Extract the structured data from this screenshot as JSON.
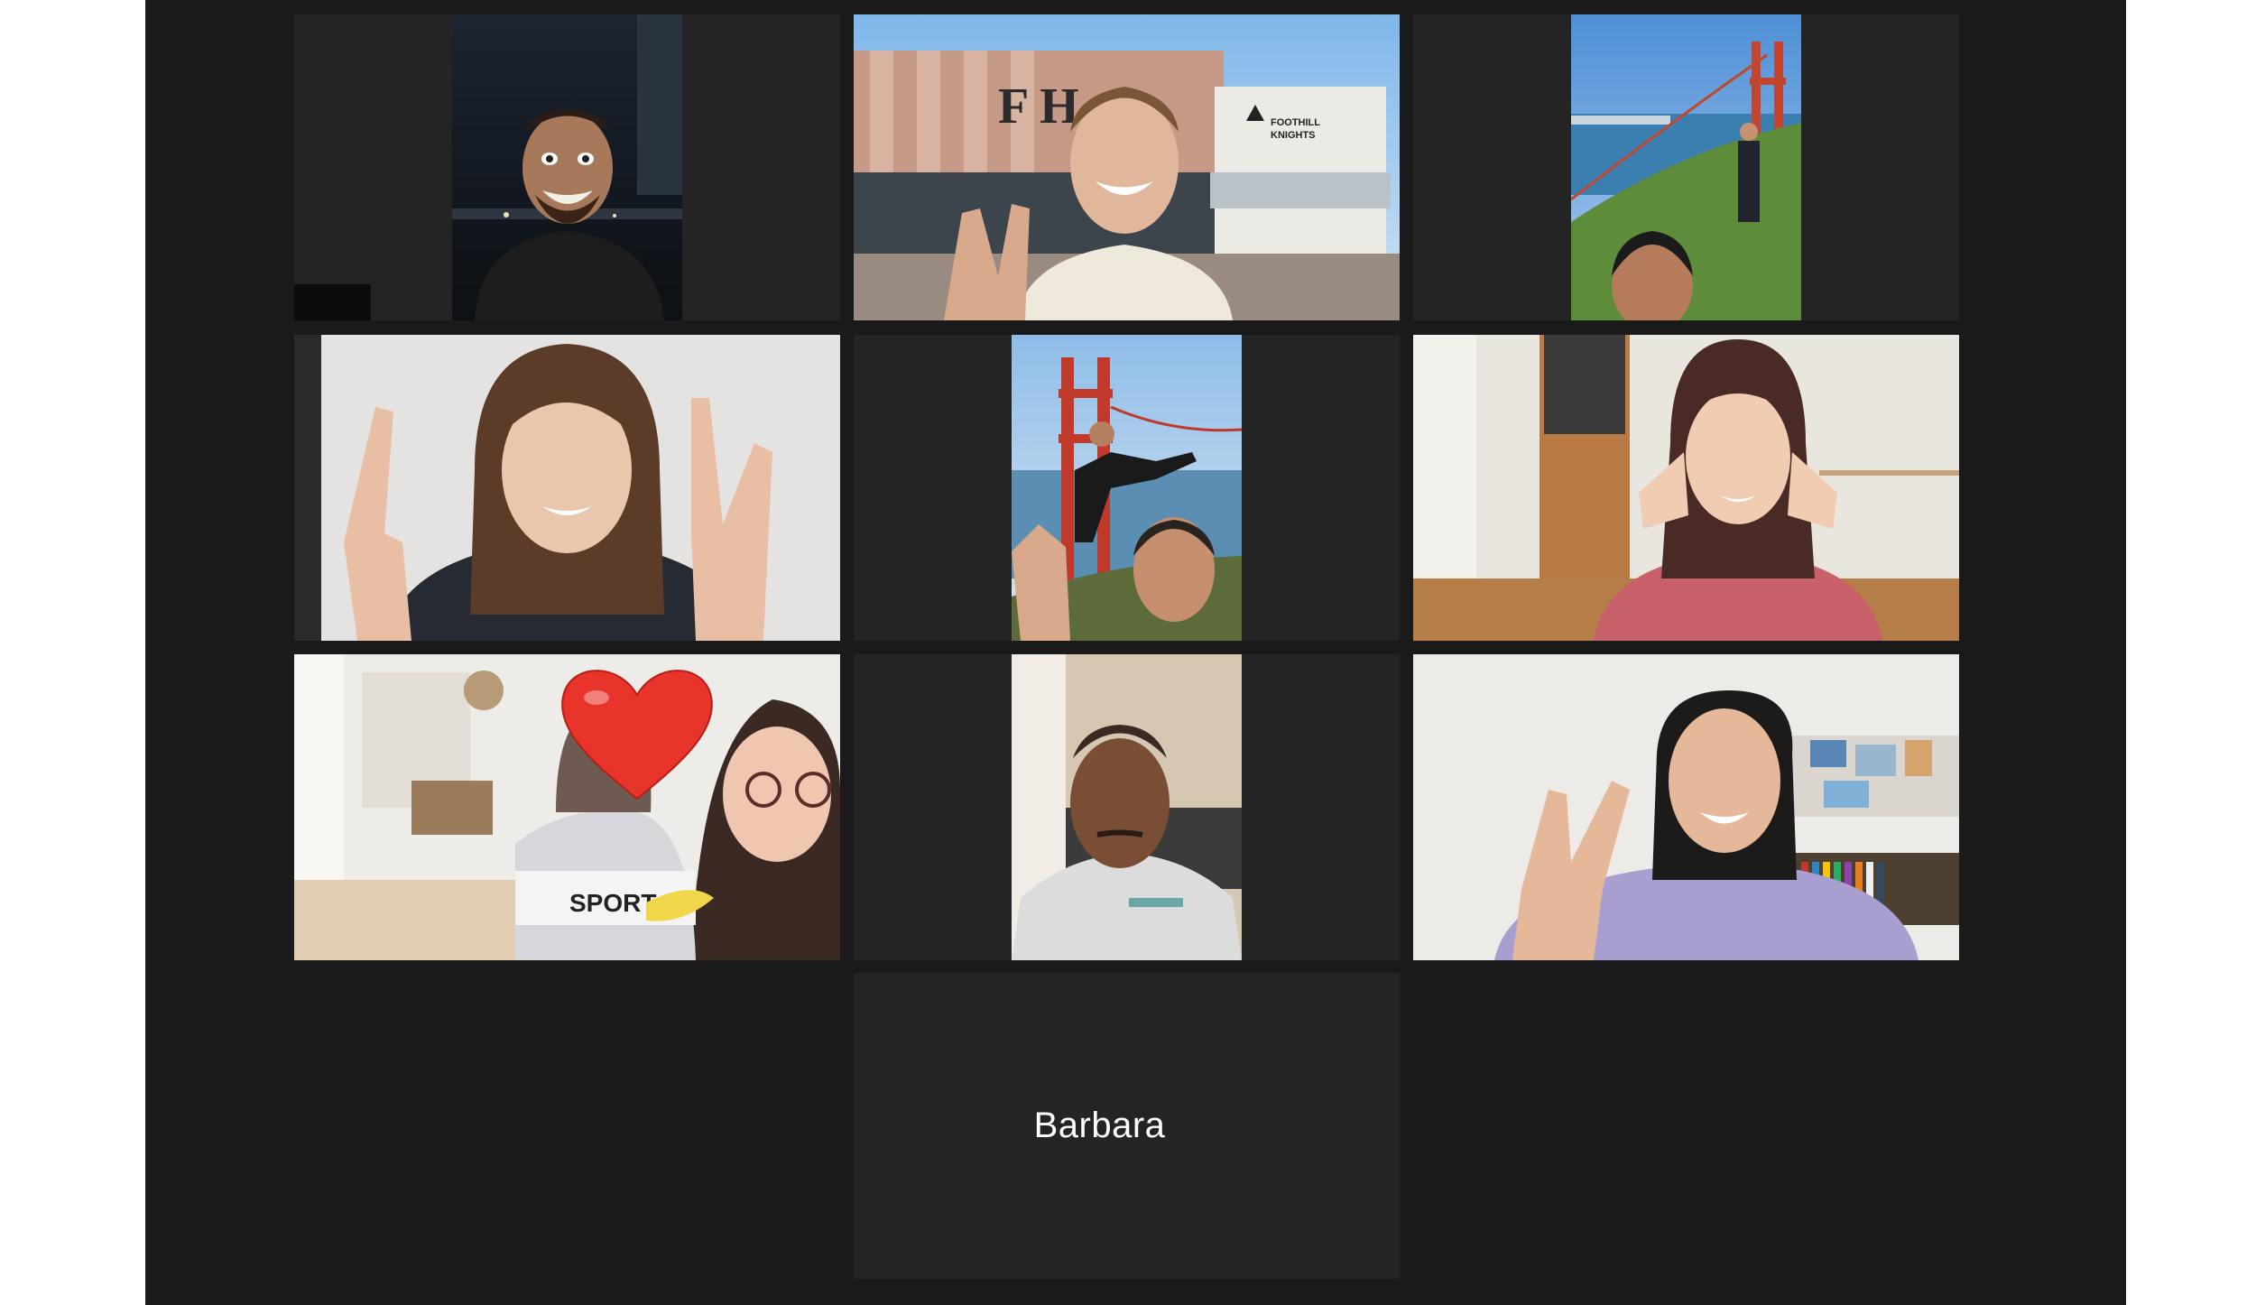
{
  "meeting": {
    "participants": [
      {
        "id": "p1",
        "active": true
      },
      {
        "id": "p2"
      },
      {
        "id": "p3"
      },
      {
        "id": "p4"
      },
      {
        "id": "p5"
      },
      {
        "id": "p6"
      },
      {
        "id": "p7"
      },
      {
        "id": "p8"
      },
      {
        "id": "p9"
      },
      {
        "id": "p10",
        "name": "Barbara",
        "video": false
      }
    ],
    "building_sign": {
      "letters": "F H",
      "logo_text_1": "FOOTHILL",
      "logo_text_2": "KNIGHTS"
    },
    "shirt_text": "SPORT",
    "sticker": "heart-sticker",
    "colors": {
      "background": "#1a1a1a",
      "tile": "#242424",
      "active_speaker_border": "#cddc80"
    }
  }
}
